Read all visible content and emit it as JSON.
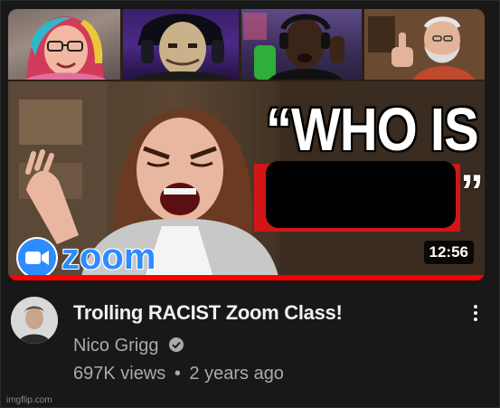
{
  "video": {
    "title": "Trolling RACIST Zoom Class!",
    "channel": "Nico Grigg",
    "verified": true,
    "views": "697K views",
    "separator": "•",
    "age": "2 years ago",
    "duration": "12:56",
    "watched_fraction": 1.0
  },
  "thumbnail": {
    "headline": "“WHO IS",
    "closing_quote": "”",
    "logo_text": "zoom",
    "redacted": true
  },
  "icons": {
    "verified": "verified-check-icon",
    "menu": "more-vert-icon",
    "logo": "zoom-camera-icon"
  },
  "colors": {
    "background": "#181818",
    "title": "#f1f1f1",
    "secondary": "#aaaaaa",
    "progress": "#ff0000",
    "redaction_border": "#d21616",
    "zoom_blue": "#2d8cff"
  },
  "watermark": "imgflip.com"
}
